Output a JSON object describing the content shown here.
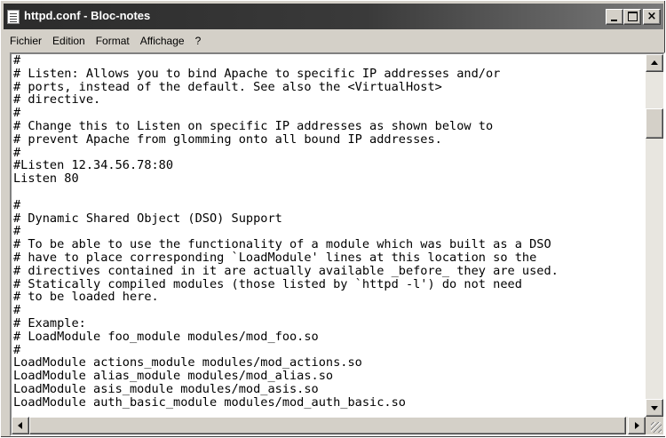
{
  "window": {
    "title": "httpd.conf - Bloc-notes",
    "buttons": {
      "minimize": "_",
      "maximize": "□",
      "close": "×"
    }
  },
  "menu": [
    "Fichier",
    "Edition",
    "Format",
    "Affichage",
    "?"
  ],
  "editor": {
    "lines": [
      "#",
      "# Listen: Allows you to bind Apache to specific IP addresses and/or",
      "# ports, instead of the default. See also the <VirtualHost>",
      "# directive.",
      "#",
      "# Change this to Listen on specific IP addresses as shown below to",
      "# prevent Apache from glomming onto all bound IP addresses.",
      "#",
      "#Listen 12.34.56.78:80",
      "Listen 80",
      "",
      "#",
      "# Dynamic Shared Object (DSO) Support",
      "#",
      "# To be able to use the functionality of a module which was built as a DSO",
      "# have to place corresponding `LoadModule' lines at this location so the",
      "# directives contained in it are actually available _before_ they are used.",
      "# Statically compiled modules (those listed by `httpd -l') do not need",
      "# to be loaded here.",
      "#",
      "# Example:",
      "# LoadModule foo_module modules/mod_foo.so",
      "#",
      "LoadModule actions_module modules/mod_actions.so",
      "LoadModule alias_module modules/mod_alias.so",
      "LoadModule asis_module modules/mod_asis.so",
      "LoadModule auth_basic_module modules/mod_auth_basic.so"
    ]
  },
  "icons": {
    "app": "notepad-icon",
    "scroll_up": "arrow-up-icon",
    "scroll_down": "arrow-down-icon",
    "scroll_left": "arrow-left-icon",
    "scroll_right": "arrow-right-icon"
  },
  "colors": {
    "titlebar": "#2b2b2b",
    "chrome": "#d4d0c8",
    "text": "#000000",
    "editor_bg": "#ffffff"
  }
}
